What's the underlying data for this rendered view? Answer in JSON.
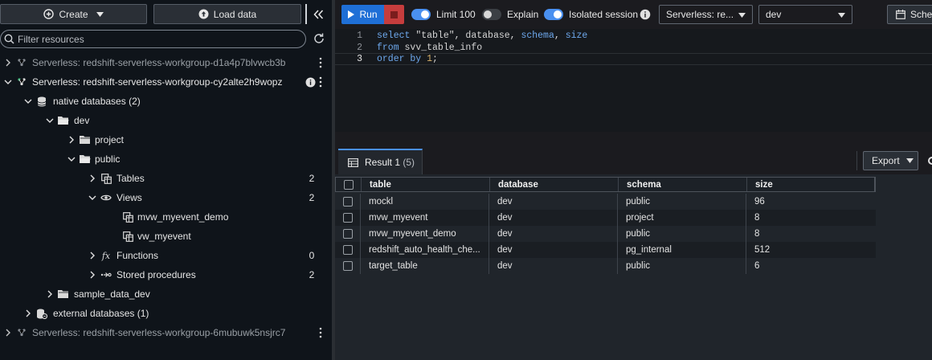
{
  "left_panel": {
    "create_label": "Create",
    "load_label": "Load data",
    "search_placeholder": "Filter resources",
    "tree": {
      "wg1": {
        "label": "Serverless: redshift-serverless-workgroup-d1a4p7blvwcb3b"
      },
      "wg2": {
        "label": "Serverless: redshift-serverless-workgroup-cy2alte2h9wopz"
      },
      "native_db": {
        "label": "native databases (2)"
      },
      "dev": {
        "label": "dev"
      },
      "project": {
        "label": "project"
      },
      "public": {
        "label": "public"
      },
      "tables": {
        "label": "Tables",
        "count": "2"
      },
      "views": {
        "label": "Views",
        "count": "2"
      },
      "view1": {
        "label": "mvw_myevent_demo"
      },
      "view2": {
        "label": "vw_myevent"
      },
      "functions": {
        "label": "Functions",
        "count": "0"
      },
      "procedures": {
        "label": "Stored procedures",
        "count": "2"
      },
      "sample_db": {
        "label": "sample_data_dev"
      },
      "external_db": {
        "label": "external databases (1)"
      },
      "wg3": {
        "label": "Serverless: redshift-serverless-workgroup-6mubuwk5nsjrc7"
      }
    }
  },
  "toolbar": {
    "run_label": "Run",
    "limit_label": "Limit 100",
    "explain_label": "Explain",
    "isolated_label": "Isolated session",
    "connection": "Serverless: re...",
    "database": "dev",
    "schedule_label": "Sched"
  },
  "editor": {
    "lines": [
      {
        "num": "1"
      },
      {
        "num": "2"
      },
      {
        "num": "3"
      }
    ],
    "line1": {
      "kw1": "select",
      "rest1": " \"table\", database, ",
      "kw2": "schema",
      "rest2": ", ",
      "kw3": "size"
    },
    "line2": {
      "kw1": "from",
      "rest1": " svv_table_info"
    },
    "line3": {
      "kw1": "order by",
      "rest1": " ",
      "num": "1",
      "rest2": ";"
    }
  },
  "results": {
    "tab_label": "Result 1",
    "tab_count": "(5)",
    "export_label": "Export",
    "columns": [
      "table",
      "database",
      "schema",
      "size"
    ],
    "rows": [
      [
        "mockl",
        "dev",
        "public",
        "96"
      ],
      [
        "mvw_myevent",
        "dev",
        "project",
        "8"
      ],
      [
        "mvw_myevent_demo",
        "dev",
        "public",
        "8"
      ],
      [
        "redshift_auto_health_che...",
        "dev",
        "pg_internal",
        "512"
      ],
      [
        "target_table",
        "dev",
        "public",
        "6"
      ]
    ]
  },
  "colors": {
    "accent": "#1f6fd6",
    "stop": "#c63d3d",
    "toggle_on": "#4a90f0",
    "keyword": "#6ea9ee",
    "number": "#d7b26b"
  }
}
